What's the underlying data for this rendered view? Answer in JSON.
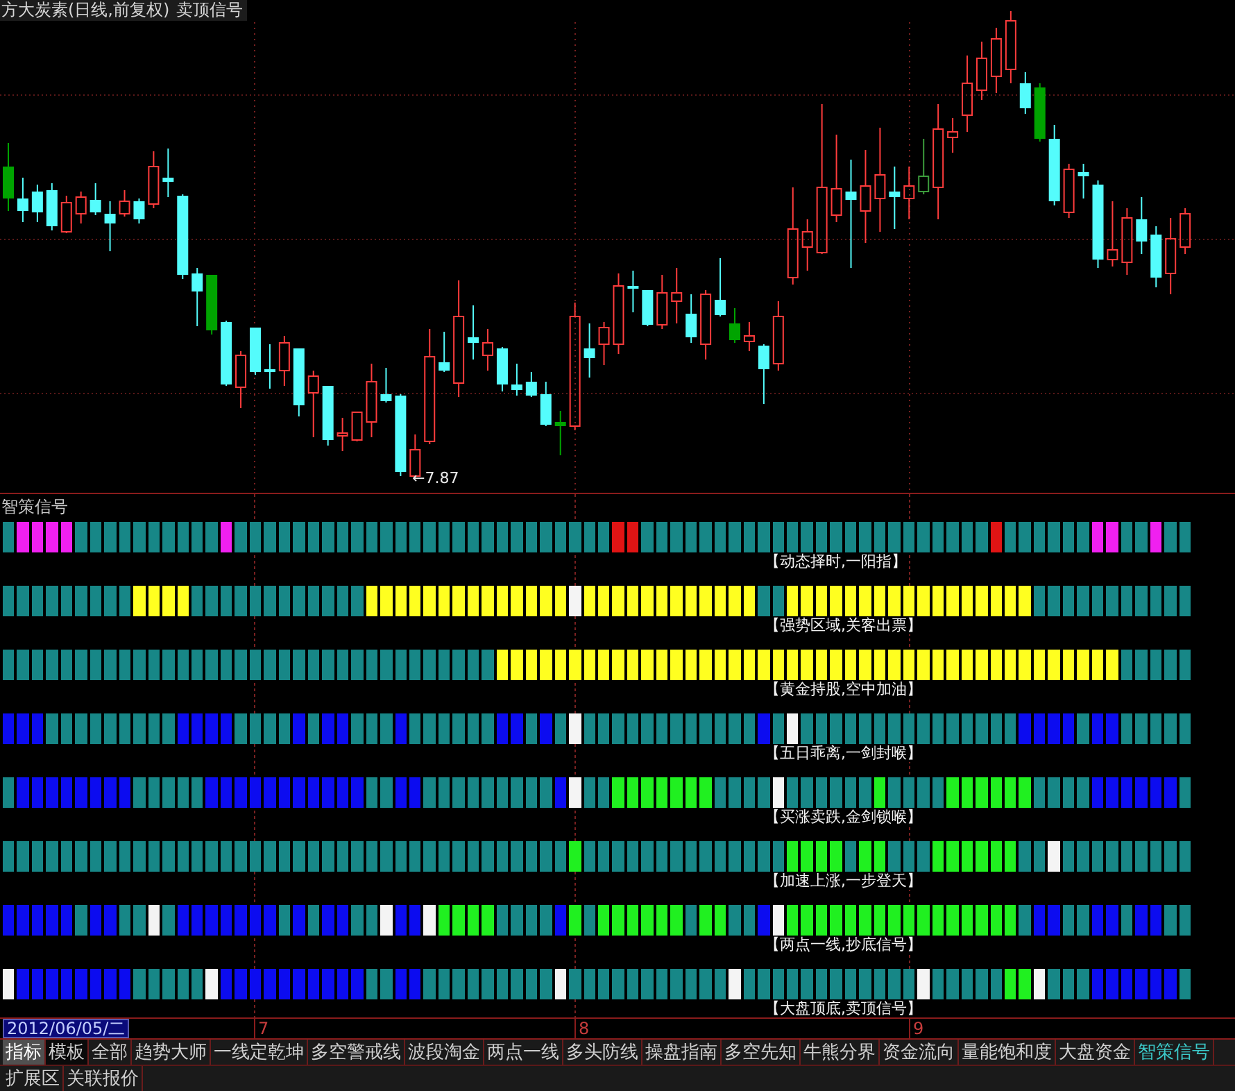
{
  "chart": {
    "title": "方大炭素(日线,前复权)",
    "indicator": "卖顶信号",
    "low_label": "←7.87"
  },
  "signal_panel": {
    "title": "智策信号",
    "rows": [
      {
        "label": "【动态择时,一阳指】",
        "cells": [
          {
            "color": "#178787"
          },
          {
            "color": "#f020f0"
          },
          {
            "color": "#f020f0"
          },
          {
            "color": "#f020f0"
          },
          {
            "color": "#f020f0"
          },
          {
            "color": "#178787"
          },
          {
            "color": "#178787"
          },
          {
            "color": "#178787"
          },
          {
            "color": "#178787"
          },
          {
            "color": "#178787"
          },
          {
            "color": "#178787"
          },
          {
            "color": "#178787"
          },
          {
            "color": "#178787"
          },
          {
            "color": "#178787"
          },
          {
            "color": "#178787"
          },
          {
            "color": "#f020f0"
          },
          {
            "color": "#178787"
          },
          {
            "color": "#178787"
          },
          {
            "color": "#178787"
          },
          {
            "color": "#178787"
          },
          {
            "color": "#178787"
          },
          {
            "color": "#178787"
          },
          {
            "color": "#178787"
          },
          {
            "color": "#178787"
          },
          {
            "color": "#178787"
          },
          {
            "color": "#178787"
          },
          {
            "color": "#178787"
          },
          {
            "color": "#178787"
          },
          {
            "color": "#178787"
          },
          {
            "color": "#178787"
          },
          {
            "color": "#178787"
          },
          {
            "color": "#178787"
          },
          {
            "color": "#178787"
          },
          {
            "color": "#178787"
          },
          {
            "color": "#178787"
          },
          {
            "color": "#178787"
          },
          {
            "color": "#178787"
          },
          {
            "color": "#178787"
          },
          {
            "color": "#178787"
          },
          {
            "color": "#178787"
          },
          {
            "color": "#178787"
          },
          {
            "color": "#178787"
          },
          {
            "color": "#e01414"
          },
          {
            "color": "#e01414"
          },
          {
            "color": "#178787"
          },
          {
            "color": "#178787"
          },
          {
            "color": "#178787"
          },
          {
            "color": "#178787"
          },
          {
            "color": "#178787"
          },
          {
            "color": "#178787"
          },
          {
            "color": "#178787"
          },
          {
            "color": "#178787"
          },
          {
            "color": "#178787"
          },
          {
            "color": "#178787"
          },
          {
            "color": "#178787"
          },
          {
            "color": "#178787"
          },
          {
            "color": "#178787"
          },
          {
            "color": "#178787"
          },
          {
            "color": "#178787"
          },
          {
            "color": "#178787"
          },
          {
            "color": "#178787"
          },
          {
            "color": "#178787"
          },
          {
            "color": "#178787"
          },
          {
            "color": "#178787"
          },
          {
            "color": "#178787"
          },
          {
            "color": "#178787"
          },
          {
            "color": "#178787"
          },
          {
            "color": "#178787"
          },
          {
            "color": "#e01414"
          },
          {
            "color": "#178787"
          },
          {
            "color": "#178787"
          },
          {
            "color": "#178787"
          },
          {
            "color": "#178787"
          },
          {
            "color": "#178787"
          },
          {
            "color": "#178787"
          },
          {
            "color": "#f020f0"
          },
          {
            "color": "#f020f0"
          },
          {
            "color": "#178787"
          },
          {
            "color": "#178787"
          },
          {
            "color": "#f020f0"
          },
          {
            "color": "#178787"
          },
          {
            "color": "#178787"
          }
        ]
      },
      {
        "label": "【强势区域,关客出票】",
        "cells": [
          {
            "color": "#178787"
          },
          {
            "color": "#178787"
          },
          {
            "color": "#178787"
          },
          {
            "color": "#178787"
          },
          {
            "color": "#178787"
          },
          {
            "color": "#178787"
          },
          {
            "color": "#178787"
          },
          {
            "color": "#178787"
          },
          {
            "color": "#178787"
          },
          {
            "color": "#ffff20"
          },
          {
            "color": "#ffff20"
          },
          {
            "color": "#ffff20"
          },
          {
            "color": "#ffff20"
          },
          {
            "color": "#178787"
          },
          {
            "color": "#178787"
          },
          {
            "color": "#178787"
          },
          {
            "color": "#178787"
          },
          {
            "color": "#178787"
          },
          {
            "color": "#178787"
          },
          {
            "color": "#178787"
          },
          {
            "color": "#178787"
          },
          {
            "color": "#178787"
          },
          {
            "color": "#178787"
          },
          {
            "color": "#178787"
          },
          {
            "color": "#178787"
          },
          {
            "color": "#ffff20"
          },
          {
            "color": "#ffff20"
          },
          {
            "color": "#ffff20"
          },
          {
            "color": "#ffff20"
          },
          {
            "color": "#ffff20"
          },
          {
            "color": "#ffff20"
          },
          {
            "color": "#ffff20"
          },
          {
            "color": "#ffff20"
          },
          {
            "color": "#ffff20"
          },
          {
            "color": "#ffff20"
          },
          {
            "color": "#ffff20"
          },
          {
            "color": "#ffff20"
          },
          {
            "color": "#ffff20"
          },
          {
            "color": "#ffff20"
          },
          {
            "color": "#f4f4f4"
          },
          {
            "color": "#ffff20"
          },
          {
            "color": "#ffff20"
          },
          {
            "color": "#ffff20"
          },
          {
            "color": "#ffff20"
          },
          {
            "color": "#ffff20"
          },
          {
            "color": "#ffff20"
          },
          {
            "color": "#ffff20"
          },
          {
            "color": "#ffff20"
          },
          {
            "color": "#ffff20"
          },
          {
            "color": "#ffff20"
          },
          {
            "color": "#ffff20"
          },
          {
            "color": "#ffff20"
          },
          {
            "color": "#178787"
          },
          {
            "color": "#178787"
          },
          {
            "color": "#ffff20"
          },
          {
            "color": "#ffff20"
          },
          {
            "color": "#ffff20"
          },
          {
            "color": "#ffff20"
          },
          {
            "color": "#ffff20"
          },
          {
            "color": "#ffff20"
          },
          {
            "color": "#ffff20"
          },
          {
            "color": "#ffff20"
          },
          {
            "color": "#ffff20"
          },
          {
            "color": "#ffff20"
          },
          {
            "color": "#ffff20"
          },
          {
            "color": "#ffff20"
          },
          {
            "color": "#ffff20"
          },
          {
            "color": "#ffff20"
          },
          {
            "color": "#ffff20"
          },
          {
            "color": "#ffff20"
          },
          {
            "color": "#ffff20"
          },
          {
            "color": "#178787"
          },
          {
            "color": "#178787"
          },
          {
            "color": "#178787"
          },
          {
            "color": "#178787"
          },
          {
            "color": "#178787"
          },
          {
            "color": "#178787"
          },
          {
            "color": "#178787"
          },
          {
            "color": "#178787"
          },
          {
            "color": "#178787"
          },
          {
            "color": "#178787"
          },
          {
            "color": "#178787"
          }
        ]
      },
      {
        "label": "【黄金持股,空中加油】",
        "cells": [
          {
            "color": "#178787"
          },
          {
            "color": "#178787"
          },
          {
            "color": "#178787"
          },
          {
            "color": "#178787"
          },
          {
            "color": "#178787"
          },
          {
            "color": "#178787"
          },
          {
            "color": "#178787"
          },
          {
            "color": "#178787"
          },
          {
            "color": "#178787"
          },
          {
            "color": "#178787"
          },
          {
            "color": "#178787"
          },
          {
            "color": "#178787"
          },
          {
            "color": "#178787"
          },
          {
            "color": "#178787"
          },
          {
            "color": "#178787"
          },
          {
            "color": "#178787"
          },
          {
            "color": "#178787"
          },
          {
            "color": "#178787"
          },
          {
            "color": "#178787"
          },
          {
            "color": "#178787"
          },
          {
            "color": "#178787"
          },
          {
            "color": "#178787"
          },
          {
            "color": "#178787"
          },
          {
            "color": "#178787"
          },
          {
            "color": "#178787"
          },
          {
            "color": "#178787"
          },
          {
            "color": "#178787"
          },
          {
            "color": "#178787"
          },
          {
            "color": "#178787"
          },
          {
            "color": "#178787"
          },
          {
            "color": "#178787"
          },
          {
            "color": "#178787"
          },
          {
            "color": "#178787"
          },
          {
            "color": "#178787"
          },
          {
            "color": "#ffff20"
          },
          {
            "color": "#ffff20"
          },
          {
            "color": "#ffff20"
          },
          {
            "color": "#ffff20"
          },
          {
            "color": "#ffff20"
          },
          {
            "color": "#ffff20"
          },
          {
            "color": "#ffff20"
          },
          {
            "color": "#ffff20"
          },
          {
            "color": "#ffff20"
          },
          {
            "color": "#ffff20"
          },
          {
            "color": "#ffff20"
          },
          {
            "color": "#ffff20"
          },
          {
            "color": "#ffff20"
          },
          {
            "color": "#ffff20"
          },
          {
            "color": "#ffff20"
          },
          {
            "color": "#ffff20"
          },
          {
            "color": "#ffff20"
          },
          {
            "color": "#ffff20"
          },
          {
            "color": "#ffff20"
          },
          {
            "color": "#ffff20"
          },
          {
            "color": "#ffff20"
          },
          {
            "color": "#ffff20"
          },
          {
            "color": "#ffff20"
          },
          {
            "color": "#ffff20"
          },
          {
            "color": "#ffff20"
          },
          {
            "color": "#ffff20"
          },
          {
            "color": "#ffff20"
          },
          {
            "color": "#ffff20"
          },
          {
            "color": "#ffff20"
          },
          {
            "color": "#ffff20"
          },
          {
            "color": "#ffff20"
          },
          {
            "color": "#ffff20"
          },
          {
            "color": "#ffff20"
          },
          {
            "color": "#ffff20"
          },
          {
            "color": "#ffff20"
          },
          {
            "color": "#ffff20"
          },
          {
            "color": "#ffff20"
          },
          {
            "color": "#ffff20"
          },
          {
            "color": "#ffff20"
          },
          {
            "color": "#ffff20"
          },
          {
            "color": "#ffff20"
          },
          {
            "color": "#ffff20"
          },
          {
            "color": "#ffff20"
          },
          {
            "color": "#178787"
          },
          {
            "color": "#178787"
          },
          {
            "color": "#178787"
          },
          {
            "color": "#178787"
          },
          {
            "color": "#178787"
          }
        ]
      },
      {
        "label": "【五日乖离,一剑封喉】",
        "cells": [
          {
            "color": "#0c0cf0"
          },
          {
            "color": "#0c0cf0"
          },
          {
            "color": "#0c0cf0"
          },
          {
            "color": "#178787"
          },
          {
            "color": "#178787"
          },
          {
            "color": "#178787"
          },
          {
            "color": "#178787"
          },
          {
            "color": "#178787"
          },
          {
            "color": "#178787"
          },
          {
            "color": "#178787"
          },
          {
            "color": "#178787"
          },
          {
            "color": "#178787"
          },
          {
            "color": "#0c0cf0"
          },
          {
            "color": "#0c0cf0"
          },
          {
            "color": "#0c0cf0"
          },
          {
            "color": "#0c0cf0"
          },
          {
            "color": "#178787"
          },
          {
            "color": "#178787"
          },
          {
            "color": "#178787"
          },
          {
            "color": "#178787"
          },
          {
            "color": "#0c0cf0"
          },
          {
            "color": "#178787"
          },
          {
            "color": "#0c0cf0"
          },
          {
            "color": "#0c0cf0"
          },
          {
            "color": "#178787"
          },
          {
            "color": "#178787"
          },
          {
            "color": "#178787"
          },
          {
            "color": "#0c0cf0"
          },
          {
            "color": "#178787"
          },
          {
            "color": "#178787"
          },
          {
            "color": "#178787"
          },
          {
            "color": "#178787"
          },
          {
            "color": "#178787"
          },
          {
            "color": "#178787"
          },
          {
            "color": "#0c0cf0"
          },
          {
            "color": "#0c0cf0"
          },
          {
            "color": "#178787"
          },
          {
            "color": "#0c0cf0"
          },
          {
            "color": "#178787"
          },
          {
            "color": "#f4f4f4"
          },
          {
            "color": "#178787"
          },
          {
            "color": "#178787"
          },
          {
            "color": "#178787"
          },
          {
            "color": "#178787"
          },
          {
            "color": "#178787"
          },
          {
            "color": "#178787"
          },
          {
            "color": "#178787"
          },
          {
            "color": "#178787"
          },
          {
            "color": "#178787"
          },
          {
            "color": "#178787"
          },
          {
            "color": "#178787"
          },
          {
            "color": "#178787"
          },
          {
            "color": "#0c0cf0"
          },
          {
            "color": "#178787"
          },
          {
            "color": "#f4f4f4"
          },
          {
            "color": "#178787"
          },
          {
            "color": "#178787"
          },
          {
            "color": "#178787"
          },
          {
            "color": "#178787"
          },
          {
            "color": "#178787"
          },
          {
            "color": "#178787"
          },
          {
            "color": "#178787"
          },
          {
            "color": "#178787"
          },
          {
            "color": "#178787"
          },
          {
            "color": "#178787"
          },
          {
            "color": "#178787"
          },
          {
            "color": "#178787"
          },
          {
            "color": "#178787"
          },
          {
            "color": "#178787"
          },
          {
            "color": "#178787"
          },
          {
            "color": "#0c0cf0"
          },
          {
            "color": "#0c0cf0"
          },
          {
            "color": "#0c0cf0"
          },
          {
            "color": "#0c0cf0"
          },
          {
            "color": "#178787"
          },
          {
            "color": "#0c0cf0"
          },
          {
            "color": "#0c0cf0"
          },
          {
            "color": "#178787"
          },
          {
            "color": "#178787"
          },
          {
            "color": "#178787"
          },
          {
            "color": "#178787"
          },
          {
            "color": "#178787"
          }
        ]
      },
      {
        "label": "【买涨卖跌,金剑锁喉】",
        "cells": [
          {
            "color": "#178787"
          },
          {
            "color": "#0c0cf0"
          },
          {
            "color": "#0c0cf0"
          },
          {
            "color": "#0c0cf0"
          },
          {
            "color": "#0c0cf0"
          },
          {
            "color": "#0c0cf0"
          },
          {
            "color": "#0c0cf0"
          },
          {
            "color": "#0c0cf0"
          },
          {
            "color": "#0c0cf0"
          },
          {
            "color": "#178787"
          },
          {
            "color": "#178787"
          },
          {
            "color": "#178787"
          },
          {
            "color": "#178787"
          },
          {
            "color": "#178787"
          },
          {
            "color": "#0c0cf0"
          },
          {
            "color": "#0c0cf0"
          },
          {
            "color": "#0c0cf0"
          },
          {
            "color": "#0c0cf0"
          },
          {
            "color": "#0c0cf0"
          },
          {
            "color": "#0c0cf0"
          },
          {
            "color": "#0c0cf0"
          },
          {
            "color": "#0c0cf0"
          },
          {
            "color": "#0c0cf0"
          },
          {
            "color": "#0c0cf0"
          },
          {
            "color": "#0c0cf0"
          },
          {
            "color": "#178787"
          },
          {
            "color": "#178787"
          },
          {
            "color": "#0c0cf0"
          },
          {
            "color": "#0c0cf0"
          },
          {
            "color": "#178787"
          },
          {
            "color": "#178787"
          },
          {
            "color": "#178787"
          },
          {
            "color": "#178787"
          },
          {
            "color": "#178787"
          },
          {
            "color": "#178787"
          },
          {
            "color": "#178787"
          },
          {
            "color": "#178787"
          },
          {
            "color": "#178787"
          },
          {
            "color": "#0c0cf0"
          },
          {
            "color": "#f4f4f4"
          },
          {
            "color": "#178787"
          },
          {
            "color": "#178787"
          },
          {
            "color": "#20f020"
          },
          {
            "color": "#20f020"
          },
          {
            "color": "#20f020"
          },
          {
            "color": "#20f020"
          },
          {
            "color": "#20f020"
          },
          {
            "color": "#20f020"
          },
          {
            "color": "#20f020"
          },
          {
            "color": "#178787"
          },
          {
            "color": "#178787"
          },
          {
            "color": "#178787"
          },
          {
            "color": "#178787"
          },
          {
            "color": "#f4f4f4"
          },
          {
            "color": "#178787"
          },
          {
            "color": "#178787"
          },
          {
            "color": "#178787"
          },
          {
            "color": "#178787"
          },
          {
            "color": "#178787"
          },
          {
            "color": "#178787"
          },
          {
            "color": "#20f020"
          },
          {
            "color": "#178787"
          },
          {
            "color": "#178787"
          },
          {
            "color": "#178787"
          },
          {
            "color": "#178787"
          },
          {
            "color": "#20f020"
          },
          {
            "color": "#20f020"
          },
          {
            "color": "#20f020"
          },
          {
            "color": "#20f020"
          },
          {
            "color": "#20f020"
          },
          {
            "color": "#20f020"
          },
          {
            "color": "#178787"
          },
          {
            "color": "#178787"
          },
          {
            "color": "#178787"
          },
          {
            "color": "#178787"
          },
          {
            "color": "#0c0cf0"
          },
          {
            "color": "#0c0cf0"
          },
          {
            "color": "#0c0cf0"
          },
          {
            "color": "#0c0cf0"
          },
          {
            "color": "#0c0cf0"
          },
          {
            "color": "#0c0cf0"
          },
          {
            "color": "#178787"
          }
        ]
      },
      {
        "label": "【加速上涨,一步登天】",
        "cells": [
          {
            "color": "#178787"
          },
          {
            "color": "#178787"
          },
          {
            "color": "#178787"
          },
          {
            "color": "#178787"
          },
          {
            "color": "#178787"
          },
          {
            "color": "#178787"
          },
          {
            "color": "#178787"
          },
          {
            "color": "#178787"
          },
          {
            "color": "#178787"
          },
          {
            "color": "#178787"
          },
          {
            "color": "#178787"
          },
          {
            "color": "#178787"
          },
          {
            "color": "#178787"
          },
          {
            "color": "#178787"
          },
          {
            "color": "#178787"
          },
          {
            "color": "#178787"
          },
          {
            "color": "#178787"
          },
          {
            "color": "#178787"
          },
          {
            "color": "#178787"
          },
          {
            "color": "#178787"
          },
          {
            "color": "#178787"
          },
          {
            "color": "#178787"
          },
          {
            "color": "#178787"
          },
          {
            "color": "#178787"
          },
          {
            "color": "#178787"
          },
          {
            "color": "#178787"
          },
          {
            "color": "#178787"
          },
          {
            "color": "#178787"
          },
          {
            "color": "#178787"
          },
          {
            "color": "#178787"
          },
          {
            "color": "#178787"
          },
          {
            "color": "#178787"
          },
          {
            "color": "#178787"
          },
          {
            "color": "#178787"
          },
          {
            "color": "#178787"
          },
          {
            "color": "#178787"
          },
          {
            "color": "#178787"
          },
          {
            "color": "#178787"
          },
          {
            "color": "#178787"
          },
          {
            "color": "#20f020"
          },
          {
            "color": "#178787"
          },
          {
            "color": "#178787"
          },
          {
            "color": "#178787"
          },
          {
            "color": "#178787"
          },
          {
            "color": "#178787"
          },
          {
            "color": "#178787"
          },
          {
            "color": "#178787"
          },
          {
            "color": "#178787"
          },
          {
            "color": "#178787"
          },
          {
            "color": "#178787"
          },
          {
            "color": "#178787"
          },
          {
            "color": "#178787"
          },
          {
            "color": "#178787"
          },
          {
            "color": "#178787"
          },
          {
            "color": "#20f020"
          },
          {
            "color": "#20f020"
          },
          {
            "color": "#20f020"
          },
          {
            "color": "#20f020"
          },
          {
            "color": "#178787"
          },
          {
            "color": "#20f020"
          },
          {
            "color": "#20f020"
          },
          {
            "color": "#178787"
          },
          {
            "color": "#178787"
          },
          {
            "color": "#178787"
          },
          {
            "color": "#20f020"
          },
          {
            "color": "#20f020"
          },
          {
            "color": "#20f020"
          },
          {
            "color": "#20f020"
          },
          {
            "color": "#20f020"
          },
          {
            "color": "#20f020"
          },
          {
            "color": "#178787"
          },
          {
            "color": "#178787"
          },
          {
            "color": "#f4f4f4"
          },
          {
            "color": "#178787"
          },
          {
            "color": "#178787"
          },
          {
            "color": "#178787"
          },
          {
            "color": "#178787"
          },
          {
            "color": "#178787"
          },
          {
            "color": "#178787"
          },
          {
            "color": "#178787"
          },
          {
            "color": "#178787"
          },
          {
            "color": "#178787"
          }
        ]
      },
      {
        "label": "【两点一线,抄底信号】",
        "cells": [
          {
            "color": "#0c0cf0"
          },
          {
            "color": "#0c0cf0"
          },
          {
            "color": "#0c0cf0"
          },
          {
            "color": "#0c0cf0"
          },
          {
            "color": "#0c0cf0"
          },
          {
            "color": "#178787"
          },
          {
            "color": "#0c0cf0"
          },
          {
            "color": "#0c0cf0"
          },
          {
            "color": "#178787"
          },
          {
            "color": "#178787"
          },
          {
            "color": "#f4f4f4"
          },
          {
            "color": "#178787"
          },
          {
            "color": "#0c0cf0"
          },
          {
            "color": "#0c0cf0"
          },
          {
            "color": "#0c0cf0"
          },
          {
            "color": "#0c0cf0"
          },
          {
            "color": "#0c0cf0"
          },
          {
            "color": "#0c0cf0"
          },
          {
            "color": "#0c0cf0"
          },
          {
            "color": "#178787"
          },
          {
            "color": "#0c0cf0"
          },
          {
            "color": "#178787"
          },
          {
            "color": "#0c0cf0"
          },
          {
            "color": "#0c0cf0"
          },
          {
            "color": "#178787"
          },
          {
            "color": "#178787"
          },
          {
            "color": "#f4f4f4"
          },
          {
            "color": "#0c0cf0"
          },
          {
            "color": "#0c0cf0"
          },
          {
            "color": "#f4f4f4"
          },
          {
            "color": "#20f020"
          },
          {
            "color": "#20f020"
          },
          {
            "color": "#20f020"
          },
          {
            "color": "#20f020"
          },
          {
            "color": "#178787"
          },
          {
            "color": "#178787"
          },
          {
            "color": "#178787"
          },
          {
            "color": "#178787"
          },
          {
            "color": "#0c0cf0"
          },
          {
            "color": "#20f020"
          },
          {
            "color": "#178787"
          },
          {
            "color": "#20f020"
          },
          {
            "color": "#20f020"
          },
          {
            "color": "#20f020"
          },
          {
            "color": "#20f020"
          },
          {
            "color": "#20f020"
          },
          {
            "color": "#20f020"
          },
          {
            "color": "#178787"
          },
          {
            "color": "#20f020"
          },
          {
            "color": "#20f020"
          },
          {
            "color": "#178787"
          },
          {
            "color": "#178787"
          },
          {
            "color": "#0c0cf0"
          },
          {
            "color": "#f4f4f4"
          },
          {
            "color": "#20f020"
          },
          {
            "color": "#20f020"
          },
          {
            "color": "#20f020"
          },
          {
            "color": "#20f020"
          },
          {
            "color": "#20f020"
          },
          {
            "color": "#20f020"
          },
          {
            "color": "#20f020"
          },
          {
            "color": "#20f020"
          },
          {
            "color": "#20f020"
          },
          {
            "color": "#20f020"
          },
          {
            "color": "#20f020"
          },
          {
            "color": "#20f020"
          },
          {
            "color": "#20f020"
          },
          {
            "color": "#20f020"
          },
          {
            "color": "#20f020"
          },
          {
            "color": "#20f020"
          },
          {
            "color": "#178787"
          },
          {
            "color": "#0c0cf0"
          },
          {
            "color": "#0c0cf0"
          },
          {
            "color": "#178787"
          },
          {
            "color": "#178787"
          },
          {
            "color": "#0c0cf0"
          },
          {
            "color": "#0c0cf0"
          },
          {
            "color": "#178787"
          },
          {
            "color": "#0c0cf0"
          },
          {
            "color": "#0c0cf0"
          },
          {
            "color": "#178787"
          },
          {
            "color": "#178787"
          }
        ]
      },
      {
        "label": "【大盘顶底,卖顶信号】",
        "cells": [
          {
            "color": "#f4f4f4"
          },
          {
            "color": "#0c0cf0"
          },
          {
            "color": "#0c0cf0"
          },
          {
            "color": "#0c0cf0"
          },
          {
            "color": "#0c0cf0"
          },
          {
            "color": "#0c0cf0"
          },
          {
            "color": "#0c0cf0"
          },
          {
            "color": "#0c0cf0"
          },
          {
            "color": "#0c0cf0"
          },
          {
            "color": "#178787"
          },
          {
            "color": "#178787"
          },
          {
            "color": "#178787"
          },
          {
            "color": "#178787"
          },
          {
            "color": "#178787"
          },
          {
            "color": "#f4f4f4"
          },
          {
            "color": "#0c0cf0"
          },
          {
            "color": "#0c0cf0"
          },
          {
            "color": "#0c0cf0"
          },
          {
            "color": "#0c0cf0"
          },
          {
            "color": "#0c0cf0"
          },
          {
            "color": "#0c0cf0"
          },
          {
            "color": "#0c0cf0"
          },
          {
            "color": "#0c0cf0"
          },
          {
            "color": "#0c0cf0"
          },
          {
            "color": "#0c0cf0"
          },
          {
            "color": "#178787"
          },
          {
            "color": "#178787"
          },
          {
            "color": "#0c0cf0"
          },
          {
            "color": "#0c0cf0"
          },
          {
            "color": "#178787"
          },
          {
            "color": "#178787"
          },
          {
            "color": "#178787"
          },
          {
            "color": "#178787"
          },
          {
            "color": "#178787"
          },
          {
            "color": "#178787"
          },
          {
            "color": "#178787"
          },
          {
            "color": "#178787"
          },
          {
            "color": "#178787"
          },
          {
            "color": "#f4f4f4"
          },
          {
            "color": "#178787"
          },
          {
            "color": "#178787"
          },
          {
            "color": "#178787"
          },
          {
            "color": "#178787"
          },
          {
            "color": "#178787"
          },
          {
            "color": "#178787"
          },
          {
            "color": "#178787"
          },
          {
            "color": "#178787"
          },
          {
            "color": "#178787"
          },
          {
            "color": "#178787"
          },
          {
            "color": "#178787"
          },
          {
            "color": "#f4f4f4"
          },
          {
            "color": "#178787"
          },
          {
            "color": "#178787"
          },
          {
            "color": "#178787"
          },
          {
            "color": "#178787"
          },
          {
            "color": "#178787"
          },
          {
            "color": "#178787"
          },
          {
            "color": "#178787"
          },
          {
            "color": "#178787"
          },
          {
            "color": "#178787"
          },
          {
            "color": "#178787"
          },
          {
            "color": "#178787"
          },
          {
            "color": "#178787"
          },
          {
            "color": "#f4f4f4"
          },
          {
            "color": "#178787"
          },
          {
            "color": "#178787"
          },
          {
            "color": "#178787"
          },
          {
            "color": "#178787"
          },
          {
            "color": "#178787"
          },
          {
            "color": "#20f020"
          },
          {
            "color": "#20f020"
          },
          {
            "color": "#f4f4f4"
          },
          {
            "color": "#178787"
          },
          {
            "color": "#178787"
          },
          {
            "color": "#178787"
          },
          {
            "color": "#0c0cf0"
          },
          {
            "color": "#0c0cf0"
          },
          {
            "color": "#0c0cf0"
          },
          {
            "color": "#0c0cf0"
          },
          {
            "color": "#0c0cf0"
          },
          {
            "color": "#0c0cf0"
          },
          {
            "color": "#178787"
          }
        ]
      }
    ]
  },
  "time_axis": {
    "cursor_date": "2012/06/05/二",
    "ticks": [
      "7",
      "8",
      "9"
    ]
  },
  "tabs": {
    "modes": [
      {
        "label": "指标",
        "selected": true
      },
      {
        "label": "模板",
        "selected": false
      }
    ],
    "indicators": [
      {
        "label": "全部",
        "selected": false
      },
      {
        "label": "趋势大师",
        "selected": false
      },
      {
        "label": "一线定乾坤",
        "selected": false
      },
      {
        "label": "多空警戒线",
        "selected": false
      },
      {
        "label": "波段淘金",
        "selected": false
      },
      {
        "label": "两点一线",
        "selected": false
      },
      {
        "label": "多头防线",
        "selected": false
      },
      {
        "label": "操盘指南",
        "selected": false
      },
      {
        "label": "多空先知",
        "selected": false
      },
      {
        "label": "牛熊分界",
        "selected": false
      },
      {
        "label": "资金流向",
        "selected": false
      },
      {
        "label": "量能饱和度",
        "selected": false
      },
      {
        "label": "大盘资金",
        "selected": false
      },
      {
        "label": "智策信号",
        "selected": true
      }
    ]
  },
  "bottom_tabs": [
    {
      "label": "扩展区"
    },
    {
      "label": "关联报价"
    }
  ]
}
